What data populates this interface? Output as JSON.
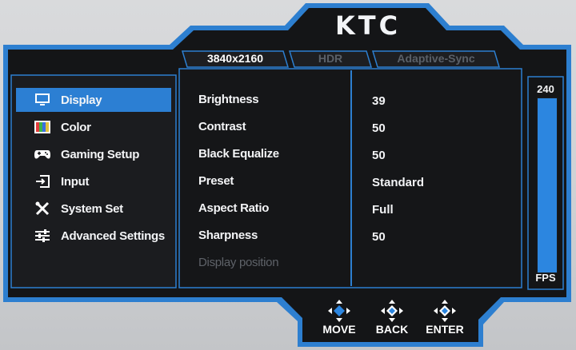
{
  "brand": {
    "logo_text": "KTC"
  },
  "tabs": [
    {
      "label": "3840x2160",
      "active": true
    },
    {
      "label": "HDR",
      "active": false
    },
    {
      "label": "Adaptive-Sync",
      "active": false
    }
  ],
  "menu": {
    "items": [
      {
        "label": "Display",
        "icon": "monitor-icon",
        "selected": true
      },
      {
        "label": "Color",
        "icon": "color-bars-icon",
        "selected": false
      },
      {
        "label": "Gaming Setup",
        "icon": "gamepad-icon",
        "selected": false
      },
      {
        "label": "Input",
        "icon": "input-icon",
        "selected": false
      },
      {
        "label": "System Set",
        "icon": "tools-icon",
        "selected": false
      },
      {
        "label": "Advanced Settings",
        "icon": "sliders-icon",
        "selected": false
      }
    ]
  },
  "settings": [
    {
      "label": "Brightness",
      "value": "39"
    },
    {
      "label": "Contrast",
      "value": "50"
    },
    {
      "label": "Black Equalize",
      "value": "50"
    },
    {
      "label": "Preset",
      "value": "Standard"
    },
    {
      "label": "Aspect Ratio",
      "value": "Full"
    },
    {
      "label": "Sharpness",
      "value": "50"
    },
    {
      "label": "Display position",
      "value": "",
      "disabled": true
    }
  ],
  "fps": {
    "value": "240",
    "unit": "FPS",
    "level": 1.0
  },
  "nav": [
    {
      "label": "MOVE",
      "icon": "dpad-icon"
    },
    {
      "label": "BACK",
      "icon": "dpad-icon"
    },
    {
      "label": "ENTER",
      "icon": "dpad-icon"
    }
  ],
  "colors": {
    "frame_blue": "#2d7fd0",
    "panel": "#151618",
    "selected": "#2c7fd3",
    "fps_fill": "#2c86e0"
  }
}
